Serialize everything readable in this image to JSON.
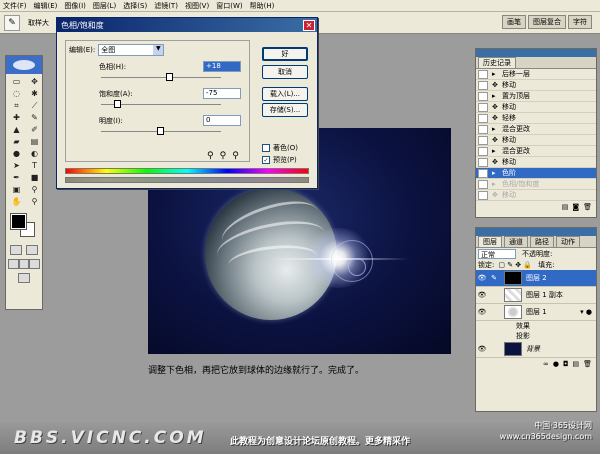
{
  "menu": [
    "文件(F)",
    "编辑(E)",
    "图像(I)",
    "图层(L)",
    "选择(S)",
    "滤镜(T)",
    "视图(V)",
    "窗口(W)",
    "帮助(H)"
  ],
  "options": {
    "sample_label": "取样大",
    "wells": [
      "画笔",
      "图层复合",
      "字符"
    ]
  },
  "dialog": {
    "title": "色相/饱和度",
    "edit_label": "编辑(E):",
    "edit_value": "全图",
    "hue_label": "色相(H):",
    "hue_value": "+18",
    "sat_label": "饱和度(A):",
    "sat_value": "-75",
    "light_label": "明度(I):",
    "light_value": "0",
    "ok": "好",
    "cancel": "取消",
    "load": "载入(L)...",
    "save": "存储(S)...",
    "colorize": "著色(O)",
    "preview": "预览(P)"
  },
  "history": {
    "tab": "历史记录",
    "items": [
      {
        "label": "后移一层",
        "state": "normal"
      },
      {
        "label": "移动",
        "state": "normal"
      },
      {
        "label": "置为顶层",
        "state": "normal"
      },
      {
        "label": "移动",
        "state": "normal"
      },
      {
        "label": "轻移",
        "state": "normal"
      },
      {
        "label": "混合更改",
        "state": "normal"
      },
      {
        "label": "移动",
        "state": "normal"
      },
      {
        "label": "混合更改",
        "state": "normal"
      },
      {
        "label": "移动",
        "state": "normal"
      },
      {
        "label": "色阶",
        "state": "selected"
      },
      {
        "label": "色相/饱和度",
        "state": "dim"
      },
      {
        "label": "移动",
        "state": "dim"
      }
    ]
  },
  "layers": {
    "tabs": [
      "图层",
      "通道",
      "路径",
      "动作"
    ],
    "blend": "正常",
    "opacity_label": "不透明度:",
    "lock_label": "锁定:",
    "fill_label": "填充:",
    "rows": [
      {
        "name": "图层 2",
        "selected": true
      },
      {
        "name": "图层 1 副本",
        "selected": false
      },
      {
        "name": "图层 1",
        "selected": false
      }
    ],
    "effects_label": "效果",
    "shadow_label": "投影",
    "background": "背景"
  },
  "caption": "调整下色相，再把它放到球体的边缘就行了。完成了。",
  "footer": {
    "logo": "BBS.VICNC.COM",
    "note": "此教程为创意设计论坛原创教程。更多精采作",
    "site_cn": "中国·365设计网",
    "site_url": "www.cn365design.com"
  }
}
